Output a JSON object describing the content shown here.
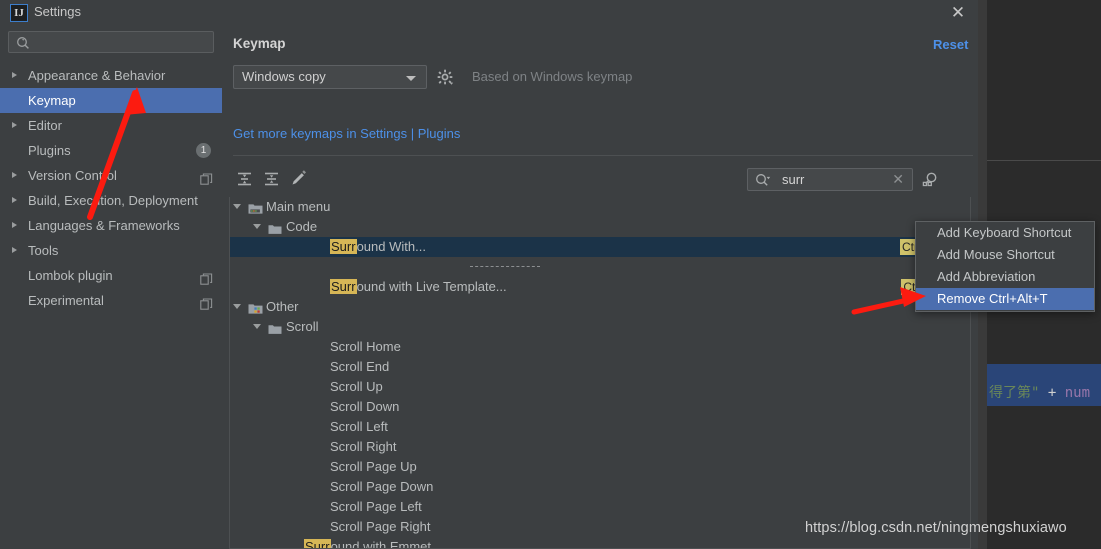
{
  "window": {
    "title": "Settings",
    "app_icon": "intellij-idea-icon",
    "close_label": "✕"
  },
  "nav": {
    "search_placeholder": "",
    "search_icon": "search-icon",
    "items": [
      {
        "label": "Appearance & Behavior",
        "arrow": true,
        "selected": false,
        "badge": null,
        "copy": false
      },
      {
        "label": "Keymap",
        "arrow": false,
        "selected": true,
        "badge": null,
        "copy": false
      },
      {
        "label": "Editor",
        "arrow": true,
        "selected": false,
        "badge": null,
        "copy": false
      },
      {
        "label": "Plugins",
        "arrow": false,
        "selected": false,
        "badge": "1",
        "copy": false
      },
      {
        "label": "Version Control",
        "arrow": true,
        "selected": false,
        "badge": null,
        "copy": true
      },
      {
        "label": "Build, Execution, Deployment",
        "arrow": true,
        "selected": false,
        "badge": null,
        "copy": false
      },
      {
        "label": "Languages & Frameworks",
        "arrow": true,
        "selected": false,
        "badge": null,
        "copy": false
      },
      {
        "label": "Tools",
        "arrow": true,
        "selected": false,
        "badge": null,
        "copy": false
      },
      {
        "label": "Lombok plugin",
        "arrow": false,
        "selected": false,
        "badge": null,
        "copy": true
      },
      {
        "label": "Experimental",
        "arrow": false,
        "selected": false,
        "badge": null,
        "copy": true
      }
    ]
  },
  "panel": {
    "title": "Keymap",
    "reset_label": "Reset",
    "keymap_selected": "Windows copy",
    "gear_icon": "gear-icon",
    "based_on": "Based on Windows keymap",
    "get_more_link": "Get more keymaps in Settings | Plugins",
    "toolbar": [
      {
        "name": "expand-all-icon",
        "title": "Expand All"
      },
      {
        "name": "collapse-all-icon",
        "title": "Collapse All"
      },
      {
        "name": "edit-pencil-icon",
        "title": "Edit Shortcut"
      }
    ],
    "search": {
      "value": "surr",
      "icon": "search-icon",
      "clear_icon": "✕",
      "find_by_shortcut_icon": "find-by-shortcut-icon"
    }
  },
  "tree": {
    "highlight_term": "Surr",
    "rows": [
      {
        "id": "main-menu",
        "depth": 0,
        "arrow": true,
        "folder": "folder-menu-icon",
        "label": "Main menu",
        "highlight": false,
        "shortcut": null,
        "selected": false,
        "separator": false
      },
      {
        "id": "code",
        "depth": 1,
        "arrow": true,
        "folder": "folder-icon",
        "label": "Code",
        "highlight": false,
        "shortcut": null,
        "selected": false,
        "separator": false
      },
      {
        "id": "surround-with",
        "depth": 2,
        "arrow": false,
        "folder": null,
        "label": "Surround With...",
        "highlight": true,
        "shortcut": "Ctrl+Alt+T",
        "selected": true,
        "separator": false
      },
      {
        "id": "sep-1",
        "depth": 2,
        "arrow": false,
        "folder": null,
        "label": "",
        "highlight": false,
        "shortcut": null,
        "selected": false,
        "separator": true
      },
      {
        "id": "surround-live-template",
        "depth": 2,
        "arrow": false,
        "folder": null,
        "label": "Surround with Live Template...",
        "highlight": true,
        "shortcut": "Ctrl+Alt+J",
        "selected": false,
        "separator": false
      },
      {
        "id": "other",
        "depth": 0,
        "arrow": true,
        "folder": "folder-other-icon",
        "label": "Other",
        "highlight": false,
        "shortcut": null,
        "selected": false,
        "separator": false
      },
      {
        "id": "scroll",
        "depth": 1,
        "arrow": true,
        "folder": "folder-icon",
        "label": "Scroll",
        "highlight": false,
        "shortcut": null,
        "selected": false,
        "separator": false
      },
      {
        "id": "scroll-home",
        "depth": 2,
        "arrow": false,
        "folder": null,
        "label": "Scroll Home",
        "highlight": false,
        "shortcut": null,
        "selected": false,
        "separator": false
      },
      {
        "id": "scroll-end",
        "depth": 2,
        "arrow": false,
        "folder": null,
        "label": "Scroll End",
        "highlight": false,
        "shortcut": null,
        "selected": false,
        "separator": false
      },
      {
        "id": "scroll-up",
        "depth": 2,
        "arrow": false,
        "folder": null,
        "label": "Scroll Up",
        "highlight": false,
        "shortcut": null,
        "selected": false,
        "separator": false
      },
      {
        "id": "scroll-down",
        "depth": 2,
        "arrow": false,
        "folder": null,
        "label": "Scroll Down",
        "highlight": false,
        "shortcut": null,
        "selected": false,
        "separator": false
      },
      {
        "id": "scroll-left",
        "depth": 2,
        "arrow": false,
        "folder": null,
        "label": "Scroll Left",
        "highlight": false,
        "shortcut": null,
        "selected": false,
        "separator": false
      },
      {
        "id": "scroll-right",
        "depth": 2,
        "arrow": false,
        "folder": null,
        "label": "Scroll Right",
        "highlight": false,
        "shortcut": null,
        "selected": false,
        "separator": false
      },
      {
        "id": "scroll-page-up",
        "depth": 2,
        "arrow": false,
        "folder": null,
        "label": "Scroll Page Up",
        "highlight": false,
        "shortcut": null,
        "selected": false,
        "separator": false
      },
      {
        "id": "scroll-page-down",
        "depth": 2,
        "arrow": false,
        "folder": null,
        "label": "Scroll Page Down",
        "highlight": false,
        "shortcut": null,
        "selected": false,
        "separator": false
      },
      {
        "id": "scroll-page-left",
        "depth": 2,
        "arrow": false,
        "folder": null,
        "label": "Scroll Page Left",
        "highlight": false,
        "shortcut": null,
        "selected": false,
        "separator": false
      },
      {
        "id": "scroll-page-right",
        "depth": 2,
        "arrow": false,
        "folder": null,
        "label": "Scroll Page Right",
        "highlight": false,
        "shortcut": null,
        "selected": false,
        "separator": false
      },
      {
        "id": "surround-with-emmet",
        "depth": 1,
        "arrow": false,
        "folder": null,
        "label": "Surround with Emmet",
        "highlight": true,
        "shortcut": null,
        "selected": false,
        "separator": false
      }
    ]
  },
  "context_menu": {
    "items": [
      {
        "label": "Add Keyboard Shortcut",
        "active": false
      },
      {
        "label": "Add Mouse Shortcut",
        "active": false
      },
      {
        "label": "Add Abbreviation",
        "active": false
      },
      {
        "label": "Remove Ctrl+Alt+T",
        "active": true
      }
    ]
  },
  "background_editor": {
    "code_cn": "得了第\"",
    "code_op": "+",
    "code_id": "num"
  },
  "watermark": "https://blog.csdn.net/ningmengshuxiawo",
  "colors": {
    "dialog_bg": "#3c3f41",
    "nav_selected": "#4b6eaf",
    "tree_selected": "#1b3348",
    "link": "#4d90e8",
    "search_highlight": "#d6b656",
    "shortcut_badge": "#cfc26a",
    "menu_active": "#4b6eaf",
    "annotation_arrow": "#fc1b10"
  }
}
